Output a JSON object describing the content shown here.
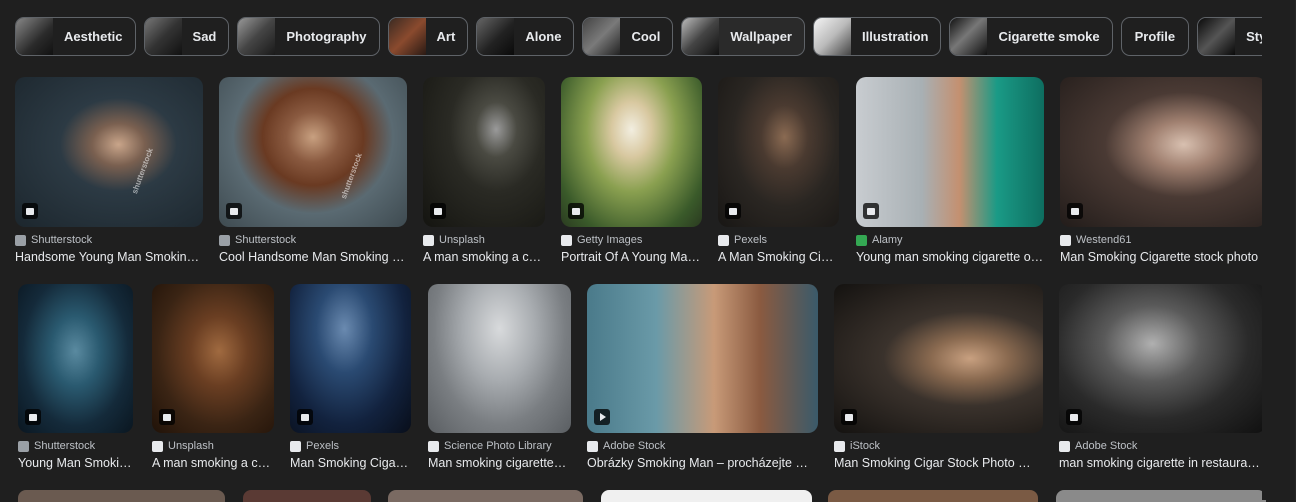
{
  "chips": [
    {
      "label": "Aesthetic",
      "thumb": "#6a6a6a"
    },
    {
      "label": "Sad",
      "thumb": "#5a5a5a"
    },
    {
      "label": "Photography",
      "thumb": "#606060"
    },
    {
      "label": "Art",
      "thumb": "#7a4030"
    },
    {
      "label": "Alone",
      "thumb": "#3a3a3a"
    },
    {
      "label": "Cool",
      "thumb": "#505050"
    },
    {
      "label": "Wallpaper",
      "thumb": "#3d3d3d"
    },
    {
      "label": "Illustration",
      "thumb": "#e0e0e0"
    },
    {
      "label": "Cigarette smoke",
      "thumb": "#2a2a2a"
    },
    {
      "label": "Profile",
      "thumb": null
    },
    {
      "label": "Stylish",
      "thumb": "#353535"
    }
  ],
  "results": [
    {
      "source": "Shutterstock",
      "title": "Handsome Young Man Smokin…",
      "fav": "#9aa0a6",
      "fav_glyph": "S"
    },
    {
      "source": "Shutterstock",
      "title": "Cool Handsome Man Smoking …",
      "fav": "#9aa0a6",
      "fav_glyph": "S"
    },
    {
      "source": "Unsplash",
      "title": "A man smoking a c…",
      "fav": "#e8eaed",
      "fav_glyph": "■"
    },
    {
      "source": "Getty Images",
      "title": "Portrait Of A Young Ma…",
      "fav": "#e8eaed",
      "fav_glyph": "g"
    },
    {
      "source": "Pexels",
      "title": "A Man Smoking Ci…",
      "fav": "#e8eaed",
      "fav_glyph": "P"
    },
    {
      "source": "Alamy",
      "title": "Young man smoking cigarette o…",
      "fav": "#34a853",
      "fav_glyph": "a"
    },
    {
      "source": "Westend61",
      "title": "Man Smoking Cigarette stock photo",
      "fav": "#e8eaed",
      "fav_glyph": "W"
    },
    {
      "source": "Shutterstock",
      "title": "Young Man Smoki…",
      "fav": "#9aa0a6",
      "fav_glyph": "S"
    },
    {
      "source": "Unsplash",
      "title": "A man smoking a c…",
      "fav": "#e8eaed",
      "fav_glyph": "■"
    },
    {
      "source": "Pexels",
      "title": "Man Smoking Ciga…",
      "fav": "#e8eaed",
      "fav_glyph": "P"
    },
    {
      "source": "Science Photo Library",
      "title": "Man smoking cigarette…",
      "fav": "#e8eaed",
      "fav_glyph": "▣"
    },
    {
      "source": "Adobe Stock",
      "title": "Obrázky Smoking Man – procházejte …",
      "fav": "#e8eaed",
      "fav_glyph": "A"
    },
    {
      "source": "iStock",
      "title": "Man Smoking Cigar Stock Photo …",
      "fav": "#e8eaed",
      "fav_glyph": "iS"
    },
    {
      "source": "Adobe Stock",
      "title": "man smoking cigarette in restauran…",
      "fav": "#e8eaed",
      "fav_glyph": "A"
    }
  ],
  "watermarks": {
    "shutterstock": "shutterstock"
  }
}
